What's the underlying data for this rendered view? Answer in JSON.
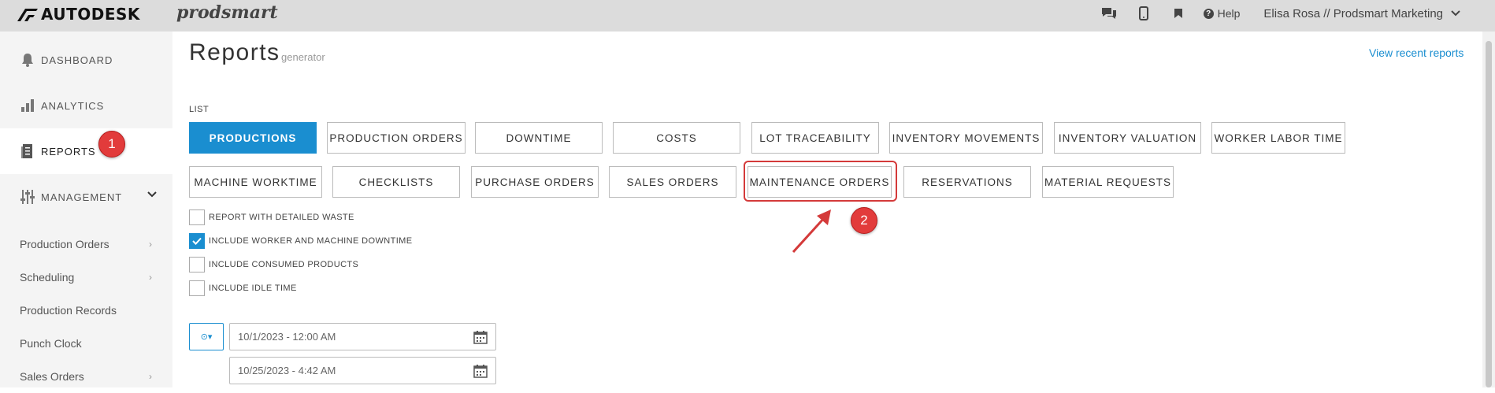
{
  "header": {
    "brand": "AUTODESK",
    "product": "prodsmart",
    "help_label": "Help",
    "user_label": "Elisa Rosa // Prodsmart Marketing"
  },
  "sidebar": {
    "nav": [
      {
        "label": "DASHBOARD",
        "icon": "bell-icon"
      },
      {
        "label": "ANALYTICS",
        "icon": "bar-chart-icon"
      },
      {
        "label": "REPORTS",
        "icon": "report-icon",
        "active": true
      },
      {
        "label": "MANAGEMENT",
        "icon": "sliders-icon",
        "expanded": true
      }
    ],
    "sub_items": [
      {
        "label": "Production Orders",
        "has_arrow": true
      },
      {
        "label": "Scheduling",
        "has_arrow": true
      },
      {
        "label": "Production Records",
        "has_arrow": false
      },
      {
        "label": "Punch Clock",
        "has_arrow": false
      },
      {
        "label": "Sales Orders",
        "has_arrow": true
      }
    ]
  },
  "annotations": {
    "badge_1": "1",
    "badge_2": "2",
    "color": "#e23b3b"
  },
  "main": {
    "title": "Reports",
    "subtitle": "generator",
    "recent_link": "View recent reports",
    "list_label": "LIST",
    "report_buttons_row1": [
      "PRODUCTIONS",
      "PRODUCTION ORDERS",
      "DOWNTIME",
      "COSTS",
      "LOT TRACEABILITY",
      "INVENTORY MOVEMENTS",
      "INVENTORY VALUATION",
      "WORKER LABOR TIME"
    ],
    "report_buttons_row2": [
      "MACHINE WORKTIME",
      "CHECKLISTS",
      "PURCHASE ORDERS",
      "SALES ORDERS",
      "MAINTENANCE ORDERS",
      "RESERVATIONS",
      "MATERIAL REQUESTS"
    ],
    "selected_report": "PRODUCTIONS",
    "options": [
      {
        "label": "REPORT WITH DETAILED WASTE",
        "checked": false
      },
      {
        "label": "INCLUDE WORKER AND MACHINE DOWNTIME",
        "checked": true
      },
      {
        "label": "INCLUDE CONSUMED PRODUCTS",
        "checked": false
      },
      {
        "label": "INCLUDE IDLE TIME",
        "checked": false
      }
    ],
    "date_from": "10/1/2023 - 12:00 AM",
    "date_to": "10/25/2023 - 4:42 AM",
    "mode_symbol": "⊙▾"
  },
  "colors": {
    "accent": "#1a8ed0",
    "topbar_bg": "#dcdcdc",
    "sidebar_bg": "#f4f4f4"
  }
}
